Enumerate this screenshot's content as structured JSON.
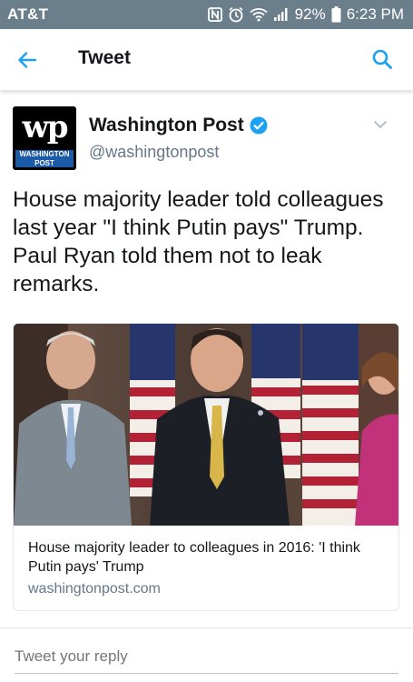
{
  "status_bar": {
    "carrier": "AT&T",
    "battery": "92%",
    "time": "6:23 PM",
    "icons": [
      "nfc-icon",
      "alarm-icon",
      "wifi-icon",
      "signal-icon",
      "battery-icon"
    ]
  },
  "header": {
    "title": "Tweet",
    "back_icon": "back-arrow-icon",
    "search_icon": "search-icon"
  },
  "tweet": {
    "author": {
      "name": "Washington Post",
      "handle": "@washingtonpost",
      "verified": true,
      "avatar_mark": "wp",
      "avatar_text": "WASHINGTON POST"
    },
    "text": "House majority leader told colleagues last year \"I think Putin pays\" Trump. Paul Ryan told them not to leak remarks.",
    "card": {
      "title": "House majority leader to colleagues in 2016: 'I think Putin pays' Trump",
      "domain": "washingtonpost.com"
    }
  },
  "reply": {
    "placeholder": "Tweet your reply"
  },
  "colors": {
    "status_bar": "#6b7e8c",
    "accent": "#1da1f2",
    "secondary_text": "#657786"
  }
}
